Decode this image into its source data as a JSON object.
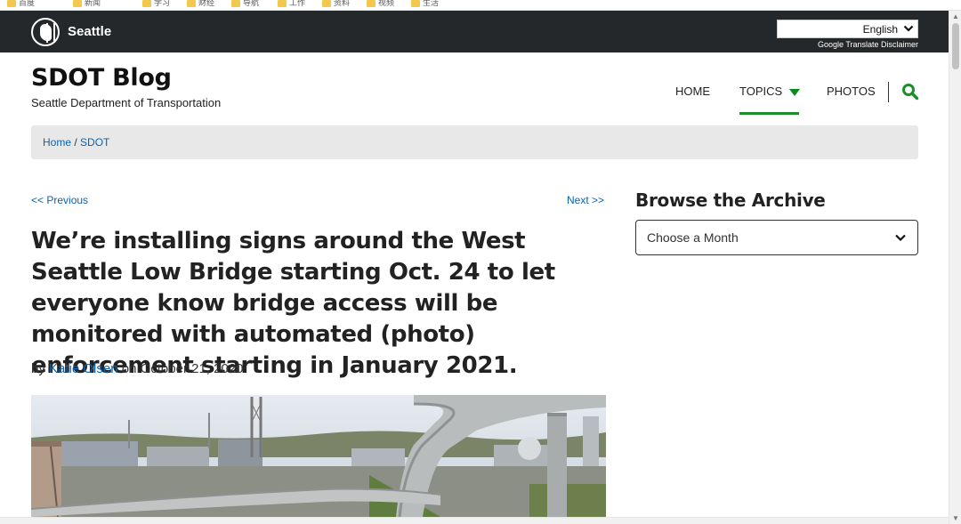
{
  "browser": {
    "bookmarks": [
      "百度",
      "新闻",
      "学习",
      "财经",
      "导航",
      "工作",
      "资料",
      "视频",
      "生活"
    ]
  },
  "city_bar": {
    "city_name": "Seattle",
    "language": "English",
    "translate_disclaimer": "Google Translate Disclaimer"
  },
  "header": {
    "title": "SDOT Blog",
    "subtitle": "Seattle Department of Transportation",
    "nav": {
      "home": "HOME",
      "topics": "TOPICS",
      "photos": "PHOTOS"
    },
    "accent_color": "#1a8f2a"
  },
  "breadcrumb": {
    "home": "Home",
    "separator": " / ",
    "current": "SDOT"
  },
  "post": {
    "prev": "<< Previous",
    "next": "Next >>",
    "title": "We’re installing signs around the West Seattle Low Bridge starting Oct. 24 to let everyone know bridge access will be monitored with automated (photo) enforcement starting in January 2021.",
    "by": "by",
    "author": "Katie Olsen",
    "on": "on",
    "date": "October 21, 2020"
  },
  "sidebar": {
    "heading": "Browse the Archive",
    "select_placeholder": "Choose a Month"
  },
  "colors": {
    "link": "#0a62b3",
    "topbar": "#25282b"
  }
}
